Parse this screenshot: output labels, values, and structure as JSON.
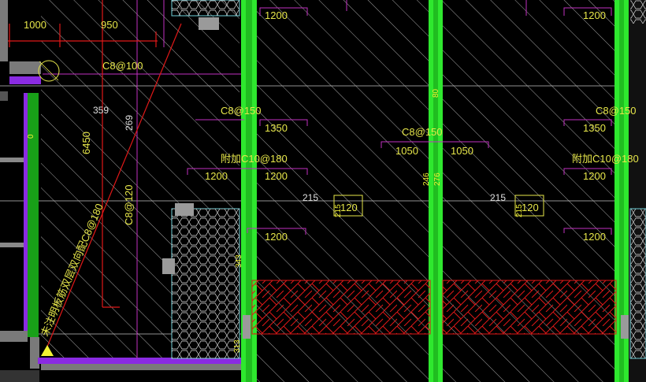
{
  "labels": {
    "dim_1000": "1000",
    "dim_950": "950",
    "rebar_c8_100": "C8@100",
    "dim_359": "359",
    "dim_269": "269",
    "dim_6450": "6450",
    "rebar_c8_150_left": "C8@150",
    "dim_1350_left": "1350",
    "rebar_c8_150_mid": "C8@150",
    "dim_1050_a": "1050",
    "dim_1050_b": "1050",
    "rebar_c8_150_right": "C8@150",
    "dim_1350_right": "1350",
    "added_c10_left": "附加C10@180",
    "added_c10_right": "附加C10@180",
    "dim_1200_tl": "1200",
    "dim_1200_tr": "1200",
    "dim_1200_ml": "1200",
    "dim_1200_mid_a": "1200",
    "dim_1200_mid_b": "1200",
    "dim_1200_r": "1200",
    "dim_1200_bl": "1200",
    "dim_1200_br": "1200",
    "dim_215_a": "215",
    "dim_215_b": "215",
    "box_120_a": "120",
    "box_120_b": "120",
    "dim_215_small_a": "215",
    "dim_215_small_b": "215",
    "rebar_c8_120": "C8@120",
    "note_diag": "未注明板筋双层双向配C8@180",
    "tag_276": "276",
    "tag_246": "246",
    "tag_80": "80",
    "tag_343": "343",
    "tag_313": "313",
    "tag_0": "0"
  },
  "colors": {
    "wall_green": "#2ee82e",
    "wall_dark_green": "#18a018",
    "dim_magenta": "#c030c0",
    "rebar_red": "#e01818",
    "text_yellow": "#e7e74a",
    "hatch_white": "#d8d8d8",
    "cyan": "#6fd0d8"
  }
}
